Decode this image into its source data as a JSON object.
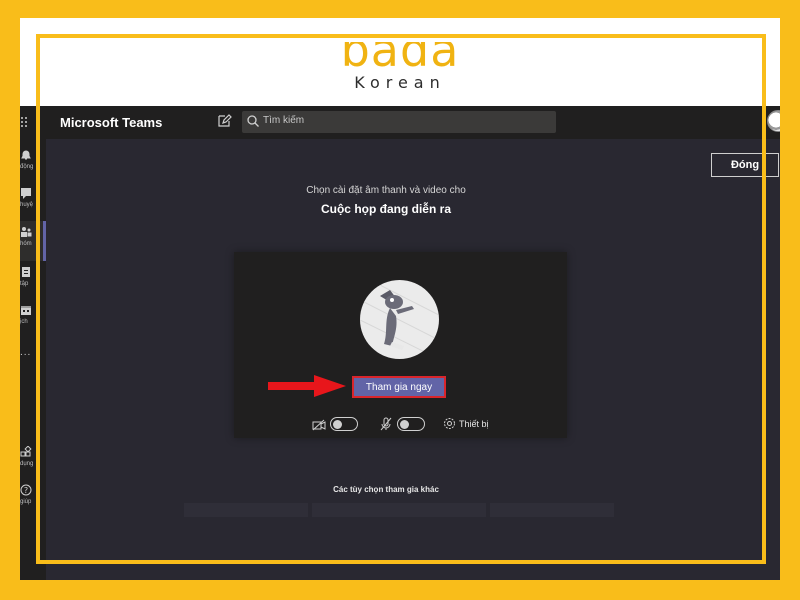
{
  "logo": {
    "main": "bada",
    "sub": "Korean"
  },
  "app": {
    "title": "Microsoft Teams"
  },
  "search": {
    "placeholder": "Tìm kiếm"
  },
  "rail": {
    "items": [
      {
        "label": "động",
        "icon": "bell-icon"
      },
      {
        "label": "huyệ",
        "icon": "chat-icon"
      },
      {
        "label": "hóm",
        "icon": "teams-icon"
      },
      {
        "label": "tập",
        "icon": "assignments-icon"
      },
      {
        "label": "ịch",
        "icon": "calendar-icon"
      }
    ],
    "more": "...",
    "bottom": [
      {
        "label": "dụng",
        "icon": "apps-icon"
      },
      {
        "label": "giúp",
        "icon": "help-icon"
      }
    ]
  },
  "meeting": {
    "close_label": "Đóng",
    "subheading": "Chọn cài đặt âm thanh và video cho",
    "heading": "Cuộc họp đang diễn ra",
    "join_label": "Tham gia ngay",
    "device_label": "Thiết bị",
    "other_options": "Các tùy chọn tham gia khác",
    "camera_on": false,
    "mic_on": false
  },
  "colors": {
    "brand_yellow": "#f9bd1a",
    "teams_purple": "#6264a7",
    "highlight_red": "#d9252c"
  }
}
